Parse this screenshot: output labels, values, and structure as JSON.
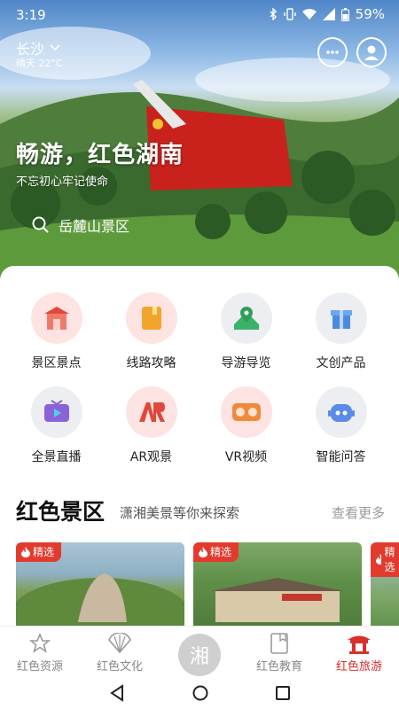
{
  "status_bar": {
    "time": "3:19",
    "battery": "59%"
  },
  "location": {
    "city": "长沙",
    "weather": "晴天 22°C"
  },
  "hero": {
    "title": "畅游，红色湖南",
    "subtitle": "不忘初心牢记使命"
  },
  "search": {
    "text": "岳麓山景区"
  },
  "services": [
    {
      "label": "景区景点",
      "icon": "gate-icon",
      "bg": "#fde3e1"
    },
    {
      "label": "线路攻略",
      "icon": "book-icon",
      "bg": "#fde3e1"
    },
    {
      "label": "导游导览",
      "icon": "map-pin-icon",
      "bg": "#eceef2"
    },
    {
      "label": "文创产品",
      "icon": "gift-icon",
      "bg": "#eceef2"
    },
    {
      "label": "全景直播",
      "icon": "tv-icon",
      "bg": "#eceef2"
    },
    {
      "label": "AR观景",
      "icon": "ar-icon",
      "bg": "#fde3e1"
    },
    {
      "label": "VR视频",
      "icon": "vr-icon",
      "bg": "#fde3e1"
    },
    {
      "label": "智能问答",
      "icon": "robot-icon",
      "bg": "#eceef2"
    }
  ],
  "section": {
    "title": "红色景区",
    "subtitle": "潇湘美景等你来探索",
    "more": "查看更多"
  },
  "scenic_cards": [
    {
      "badge": "精选"
    },
    {
      "badge": "精选"
    },
    {
      "badge": "精选"
    }
  ],
  "tabs": [
    {
      "label": "红色资源",
      "icon": "star-icon"
    },
    {
      "label": "红色文化",
      "icon": "fan-icon"
    },
    {
      "label": "湘",
      "icon": "center-logo"
    },
    {
      "label": "红色教育",
      "icon": "book-icon"
    },
    {
      "label": "红色旅游",
      "icon": "pavilion-icon"
    }
  ],
  "colors": {
    "accent": "#d9302c",
    "badge": "#e23b2e"
  }
}
